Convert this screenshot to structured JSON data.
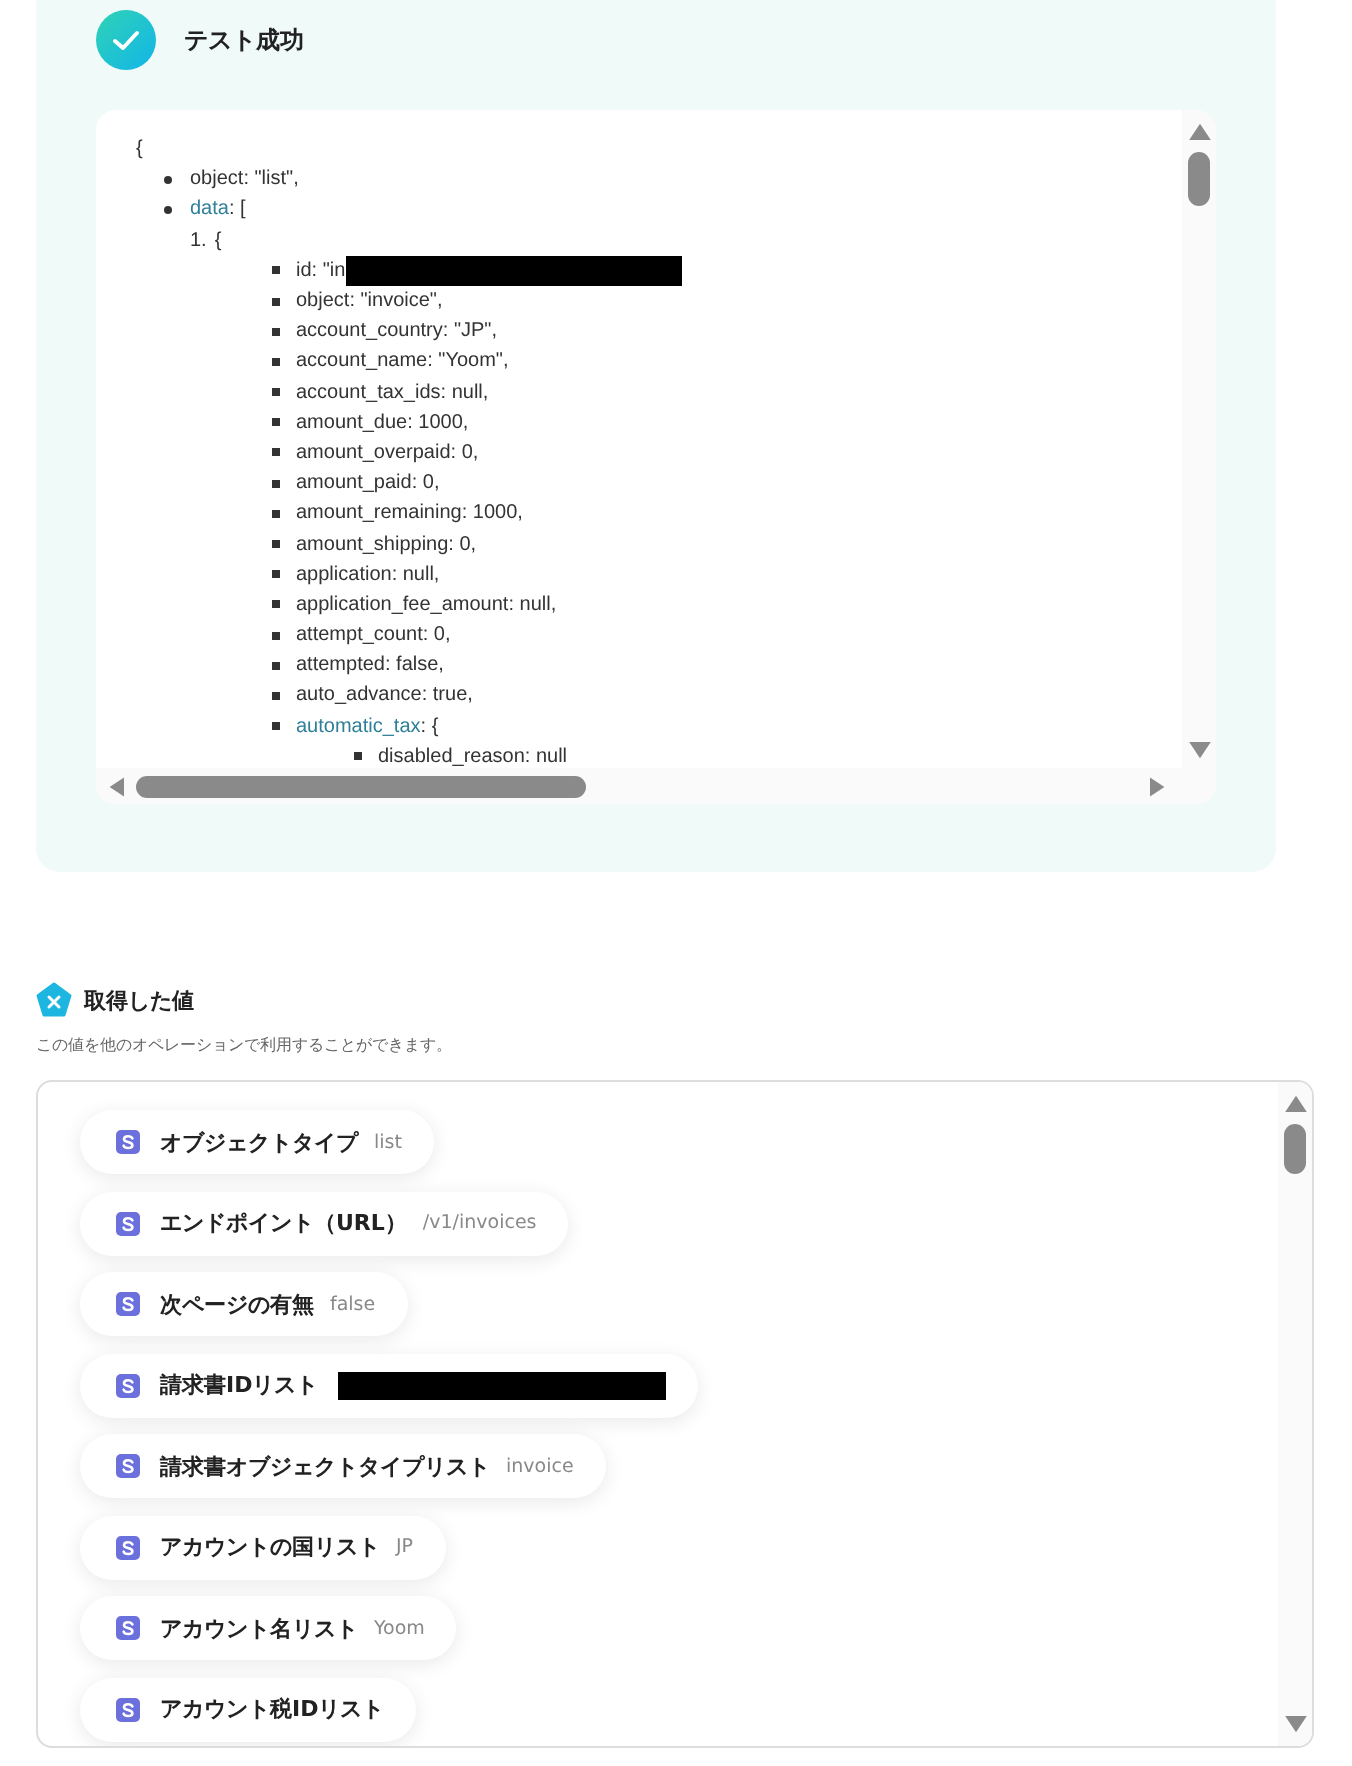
{
  "test_result": {
    "title": "テスト成功",
    "json_preview": {
      "open": "{",
      "items": [
        {
          "key": "object",
          "value": ": \"list\",",
          "linked": false
        },
        {
          "key": "data",
          "value": ": [",
          "linked": true,
          "children": [
            {
              "marker": "1.",
              "value": "{",
              "children": [
                {
                  "key": "id",
                  "value": ": \"in",
                  "linked": false,
                  "redacted": true
                },
                {
                  "key": "object",
                  "value": ": \"invoice\",",
                  "linked": false
                },
                {
                  "key": "account_country",
                  "value": ": \"JP\",",
                  "linked": false
                },
                {
                  "key": "account_name",
                  "value": ": \"Yoom\",",
                  "linked": false
                },
                {
                  "key": "account_tax_ids",
                  "value": ": null,",
                  "linked": false
                },
                {
                  "key": "amount_due",
                  "value": ": 1000,",
                  "linked": false
                },
                {
                  "key": "amount_overpaid",
                  "value": ": 0,",
                  "linked": false
                },
                {
                  "key": "amount_paid",
                  "value": ": 0,",
                  "linked": false
                },
                {
                  "key": "amount_remaining",
                  "value": ": 1000,",
                  "linked": false
                },
                {
                  "key": "amount_shipping",
                  "value": ": 0,",
                  "linked": false
                },
                {
                  "key": "application",
                  "value": ": null,",
                  "linked": false
                },
                {
                  "key": "application_fee_amount",
                  "value": ": null,",
                  "linked": false
                },
                {
                  "key": "attempt_count",
                  "value": ": 0,",
                  "linked": false
                },
                {
                  "key": "attempted",
                  "value": ": false,",
                  "linked": false
                },
                {
                  "key": "auto_advance",
                  "value": ": true,",
                  "linked": false
                },
                {
                  "key": "automatic_tax",
                  "value": ": {",
                  "linked": true,
                  "children": [
                    {
                      "key": "disabled_reason",
                      "value": ": null",
                      "linked": false
                    }
                  ]
                }
              ]
            }
          ]
        }
      ]
    }
  },
  "retrieved_values": {
    "title": "取得した値",
    "description": "この値を他のオペレーションで利用することができます。",
    "items": [
      {
        "label": "オブジェクトタイプ",
        "value": "list",
        "redacted": false
      },
      {
        "label": "エンドポイント（URL）",
        "value": "/v1/invoices",
        "redacted": false
      },
      {
        "label": "次ページの有無",
        "value": "false",
        "redacted": false
      },
      {
        "label": "請求書IDリスト",
        "redacted": true
      },
      {
        "label": "請求書オブジェクトタイプリスト",
        "value": "invoice",
        "redacted": false
      },
      {
        "label": "アカウントの国リスト",
        "value": "JP",
        "redacted": false
      },
      {
        "label": "アカウント名リスト",
        "value": "Yoom",
        "redacted": false
      },
      {
        "label": "アカウント税IDリスト",
        "redacted": false
      }
    ]
  }
}
